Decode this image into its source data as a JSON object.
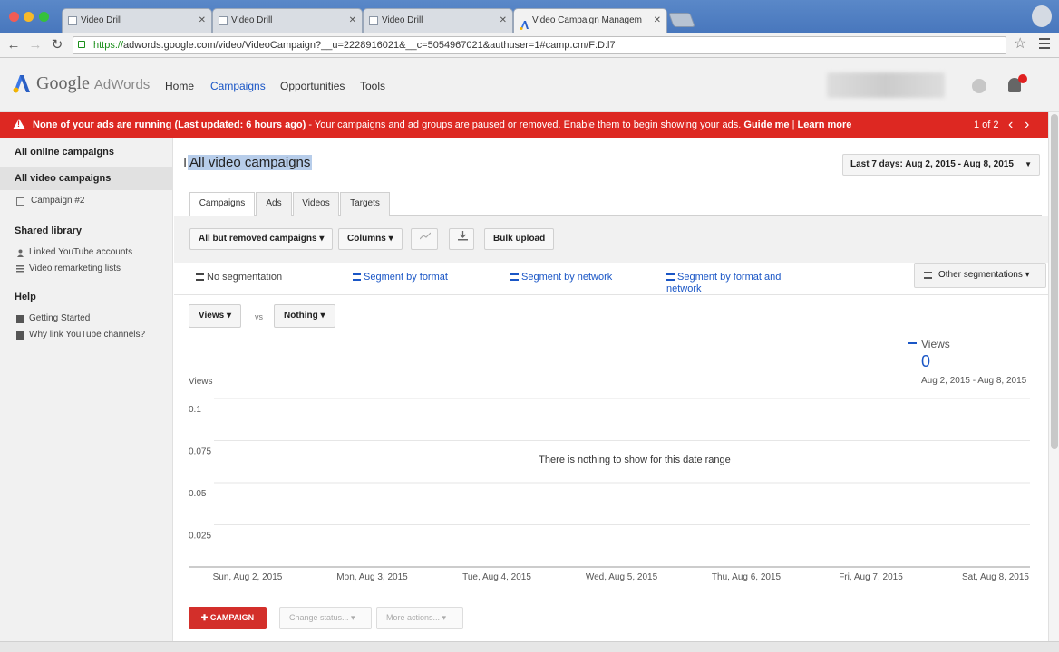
{
  "browser": {
    "tabs": [
      {
        "title": "Video Drill"
      },
      {
        "title": "Video Drill"
      },
      {
        "title": "Video Drill"
      },
      {
        "title": "Video Campaign Managem"
      }
    ],
    "url_scheme": "https://",
    "url_rest": "adwords.google.com/video/VideoCampaign?__u=2228916021&__c=5054967021&authuser=1#camp.cm/F:D:l7"
  },
  "header": {
    "logo_google": "Google",
    "logo_product": "AdWords",
    "nav": [
      "Home",
      "Campaigns",
      "Opportunities",
      "Tools"
    ],
    "active_nav": "Campaigns"
  },
  "alert": {
    "bold": "None of your ads are running (Last updated: 6 hours ago)",
    "text": " - Your campaigns and ad groups are paused or removed. Enable them to begin showing your ads.",
    "link1": "Guide me",
    "sep": "|",
    "link2": "Learn more",
    "pager": "1 of 2"
  },
  "sidebar": {
    "all_online": "All online campaigns",
    "all_video": "All video campaigns",
    "campaign": "Campaign #2",
    "shared_library": "Shared library",
    "linked_youtube": "Linked YouTube accounts",
    "remarketing": "Video remarketing lists",
    "help": "Help",
    "getting_started": "Getting Started",
    "why_link": "Why link YouTube channels?"
  },
  "main": {
    "title": "All video campaigns",
    "date_range": "Last 7 days: Aug 2, 2015 - Aug 8, 2015",
    "tabs": [
      "Campaigns",
      "Ads",
      "Videos",
      "Targets"
    ],
    "active_tab": "Campaigns",
    "toolbar": {
      "filter": "All but removed campaigns",
      "columns": "Columns",
      "bulk_upload": "Bulk upload"
    },
    "segments": {
      "none": "No segmentation",
      "by_format": "Segment by format",
      "by_network": "Segment by network",
      "by_format_network": "Segment by format and network",
      "other": "Other segmentations"
    },
    "metric1": "Views",
    "vs": "vs",
    "metric2": "Nothing",
    "legend": {
      "name": "Views",
      "value": "0",
      "range": "Aug 2, 2015 - Aug 8, 2015"
    },
    "empty_message": "There is nothing to show for this date range",
    "campaign_button": "CAMPAIGN",
    "change_status": "Change status...",
    "more_actions": "More actions..."
  },
  "chart_data": {
    "type": "line",
    "ylabel": "Views",
    "yticks": [
      "0.1",
      "0.075",
      "0.05",
      "0.025"
    ],
    "ylim": [
      0,
      0.1
    ],
    "categories": [
      "Sun, Aug 2, 2015",
      "Mon, Aug 3, 2015",
      "Tue, Aug 4, 2015",
      "Wed, Aug 5, 2015",
      "Thu, Aug 6, 2015",
      "Fri, Aug 7, 2015",
      "Sat, Aug 8, 2015"
    ],
    "series": []
  },
  "colors": {
    "alert": "#dd2822",
    "link": "#1a56c6",
    "primary_button": "#d32f2a"
  }
}
